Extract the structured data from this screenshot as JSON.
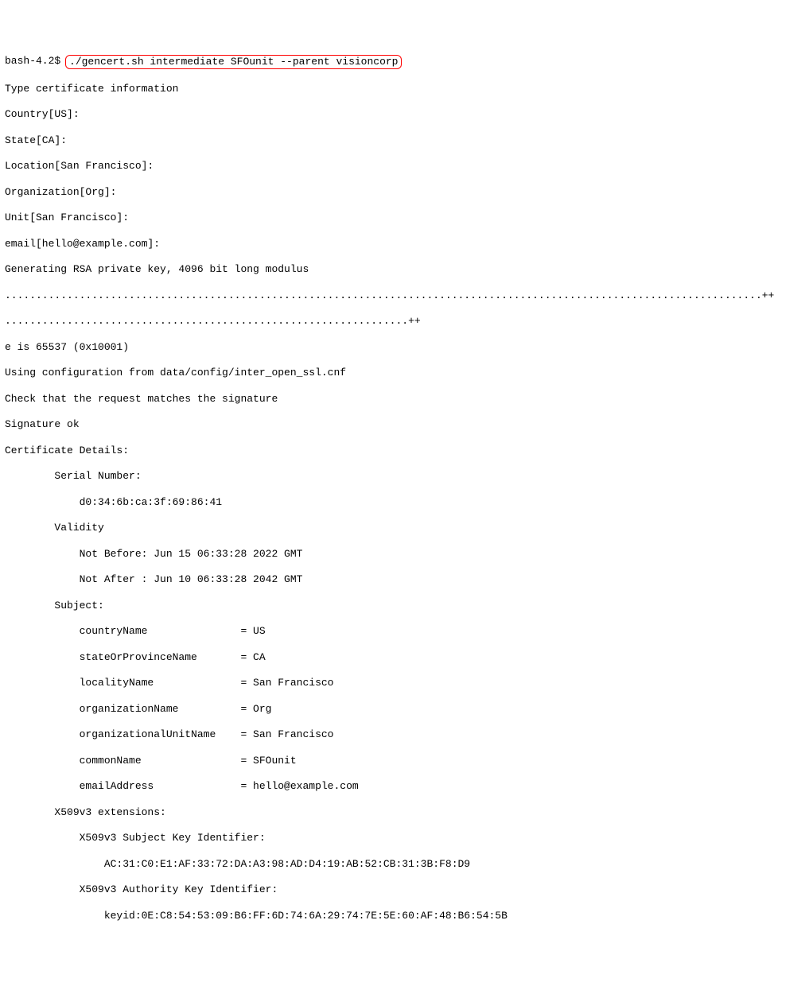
{
  "prompt": "bash-4.2$ ",
  "command": "./gencert.sh intermediate SFOunit --parent visioncorp",
  "l1": "Type certificate information",
  "l2": "Country[US]:",
  "l3": "State[CA]:",
  "l4": "Location[San Francisco]:",
  "l5": "Organization[Org]:",
  "l6": "Unit[San Francisco]:",
  "l7": "email[hello@example.com]:",
  "l8": "Generating RSA private key, 4096 bit long modulus",
  "l9": "..........................................................................................................................++",
  "l10": ".................................................................++",
  "l11": "e is 65537 (0x10001)",
  "l12": "Using configuration from data/config/inter_open_ssl.cnf",
  "l13": "Check that the request matches the signature",
  "l14": "Signature ok",
  "l15": "Certificate Details:",
  "l16": "        Serial Number:",
  "l17": "            d0:34:6b:ca:3f:69:86:41",
  "l18": "        Validity",
  "l19": "            Not Before: Jun 15 06:33:28 2022 GMT",
  "l20": "            Not After : Jun 10 06:33:28 2042 GMT",
  "l21": "        Subject:",
  "l22": "            countryName               = US",
  "l23": "            stateOrProvinceName       = CA",
  "l24": "            localityName              = San Francisco",
  "l25": "            organizationName          = Org",
  "l26": "            organizationalUnitName    = San Francisco",
  "l27": "            commonName                = SFOunit",
  "l28": "            emailAddress              = hello@example.com",
  "l29": "        X509v3 extensions:",
  "l30": "            X509v3 Subject Key Identifier: ",
  "l31": "                AC:31:C0:E1:AF:33:72:DA:A3:98:AD:D4:19:AB:52:CB:31:3B:F8:D9",
  "l32": "            X509v3 Authority Key Identifier: ",
  "l33": "                keyid:0E:C8:54:53:09:B6:FF:6D:74:6A:29:74:7E:5E:60:AF:48:B6:54:5B"
}
